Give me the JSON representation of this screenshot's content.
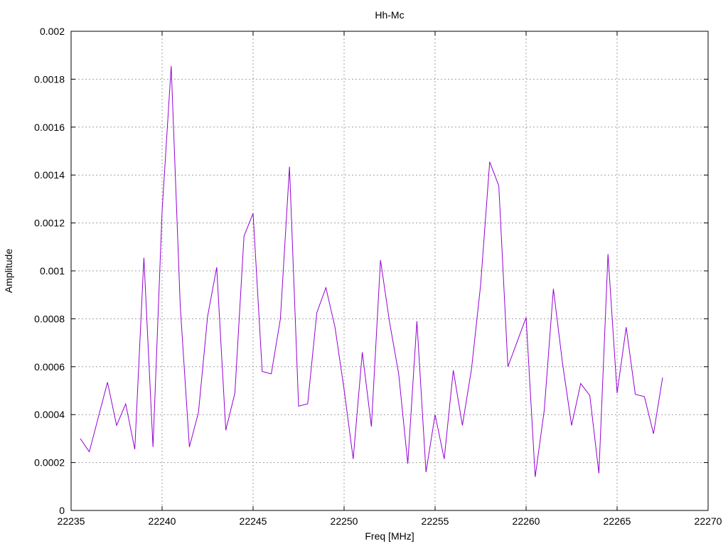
{
  "chart_data": {
    "type": "line",
    "title": "Hh-Mc",
    "xlabel": "Freq [MHz]",
    "ylabel": "Amplitude",
    "xlim": [
      22235,
      22270
    ],
    "ylim": [
      0,
      0.002
    ],
    "x_ticks": [
      "22235",
      "22240",
      "22245",
      "22250",
      "22255",
      "22260",
      "22265",
      "22270"
    ],
    "y_ticks": [
      "0",
      "0.0002",
      "0.0004",
      "0.0006",
      "0.0008",
      "0.001",
      "0.0012",
      "0.0014",
      "0.0016",
      "0.0018",
      "0.002"
    ],
    "grid": true,
    "line_color": "#9400d3",
    "series": [
      {
        "x": [
          22235.5,
          22236.0,
          22237.0,
          22237.5,
          22238.0,
          22238.5,
          22239.0,
          22239.5,
          22240.0,
          22240.5,
          22241.0,
          22241.5,
          22242.0,
          22242.5,
          22243.0,
          22243.5,
          22244.0,
          22244.5,
          22245.0,
          22245.5,
          22246.0,
          22246.5,
          22247.0,
          22247.5,
          22248.0,
          22248.5,
          22249.0,
          22249.5,
          22250.0,
          22250.5,
          22251.0,
          22251.5,
          22252.0,
          22252.5,
          22253.0,
          22253.5,
          22254.0,
          22254.5,
          22255.0,
          22255.5,
          22256.0,
          22256.5,
          22257.0,
          22257.5,
          22258.0,
          22258.5,
          22259.0,
          22260.0,
          22260.5,
          22261.0,
          22261.5,
          22262.0,
          22262.5,
          22263.0,
          22263.5,
          22264.0,
          22264.5,
          22265.0,
          22265.5,
          22266.0,
          22266.5,
          22267.0,
          22267.5
        ],
        "y": [
          0.0003,
          0.000245,
          0.000535,
          0.000355,
          0.000445,
          0.000255,
          0.001055,
          0.000265,
          0.00125,
          0.001855,
          0.00085,
          0.000265,
          0.00041,
          0.00081,
          0.001015,
          0.000335,
          0.00049,
          0.001145,
          0.00124,
          0.00058,
          0.00057,
          0.0008,
          0.001435,
          0.000435,
          0.000445,
          0.000825,
          0.00093,
          0.000765,
          0.000505,
          0.000215,
          0.00066,
          0.00035,
          0.001045,
          0.000785,
          0.00057,
          0.000195,
          0.00079,
          0.00016,
          0.0004,
          0.000215,
          0.000585,
          0.000355,
          0.00059,
          0.00094,
          0.001455,
          0.001355,
          0.0006,
          0.000805,
          0.00014,
          0.00042,
          0.000925,
          0.000615,
          0.000355,
          0.00053,
          0.00048,
          0.000155,
          0.00107,
          0.00049,
          0.000765,
          0.000485,
          0.000475,
          0.00032,
          0.000555
        ]
      }
    ]
  }
}
